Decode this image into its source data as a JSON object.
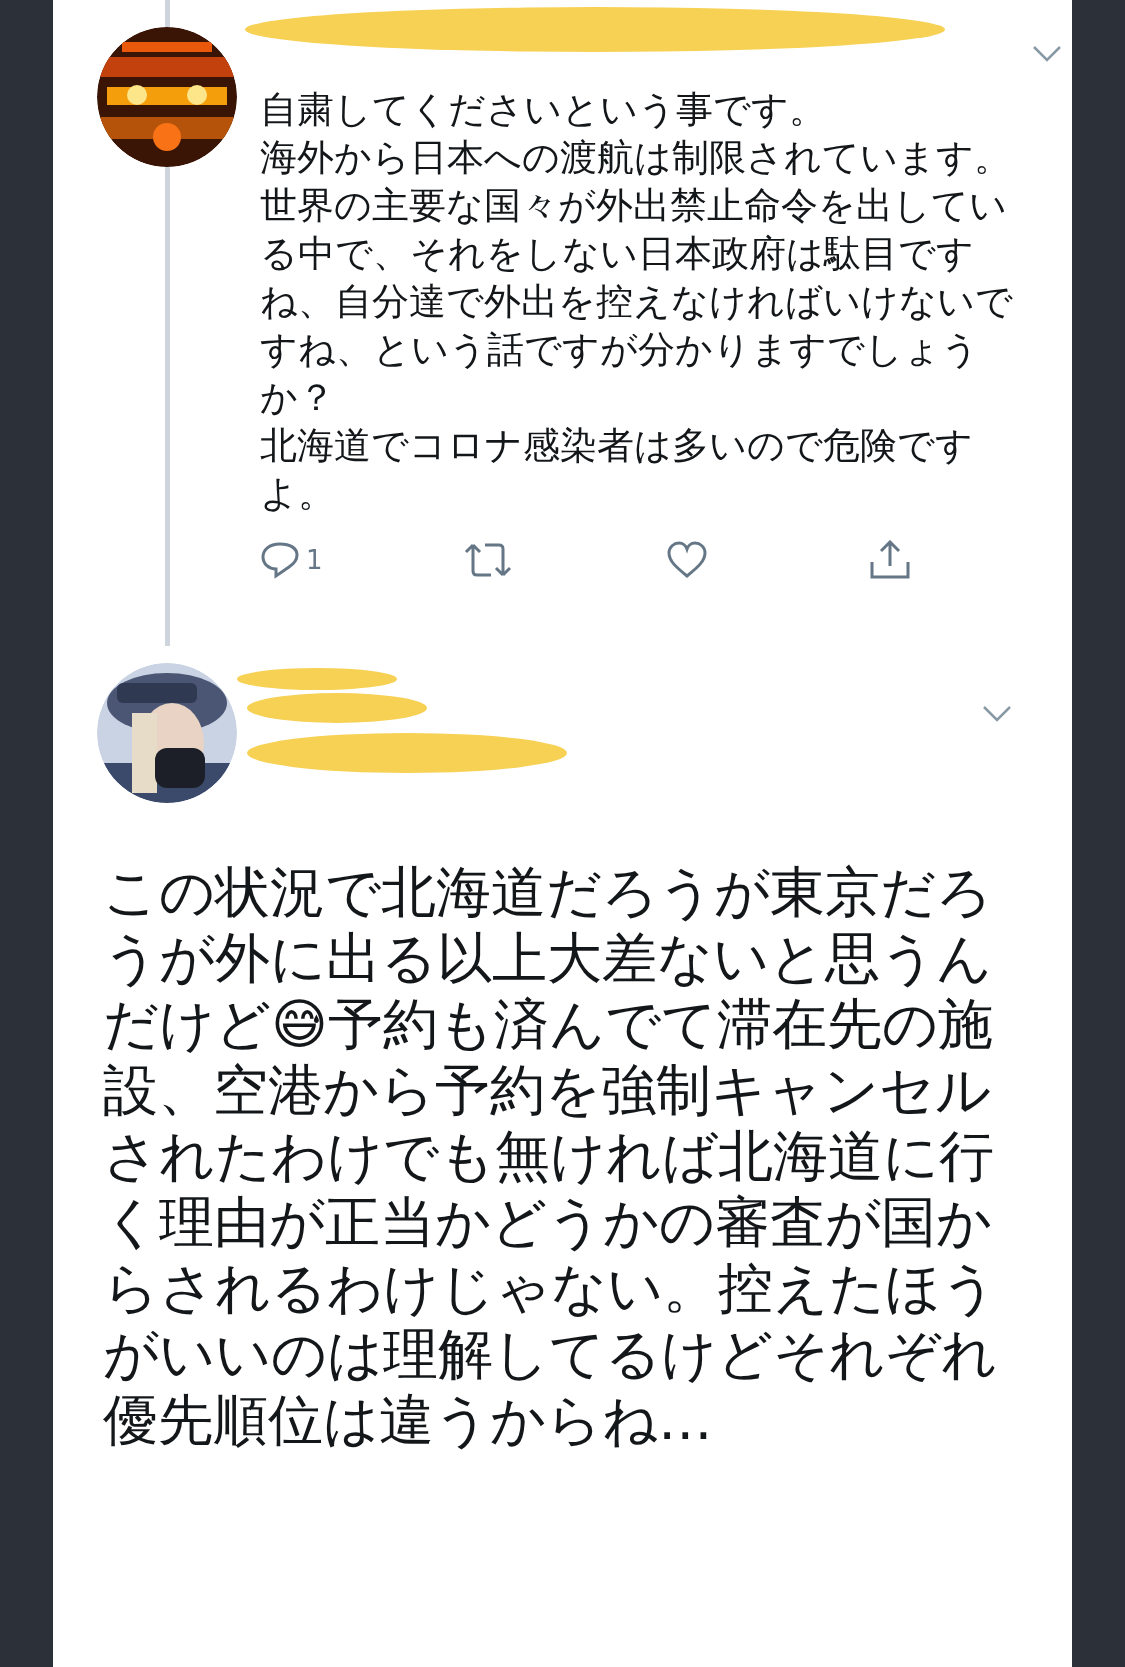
{
  "tweets": [
    {
      "kind": "reply",
      "paragraphs": [
        "自粛してくださいという事です。",
        "海外から日本への渡航は制限されています。",
        "世界の主要な国々が外出禁止命令を出している中で、それをしない日本政府は駄目ですね、自分達で外出を控えなければいけないですね、という話ですが分かりますでしょうか？",
        "北海道でコロナ感染者は多いので危険ですよ。"
      ],
      "reply_count": "1"
    },
    {
      "kind": "main",
      "paragraphs": [
        "この状況で北海道だろうが東京だろうが外に出る以上大差ないと思うんだけど😅予約も済んでて滞在先の施設、空港から予約を強制キャンセルされたわけでも無ければ北海道に行く理由が正当かどうかの審査が国からされるわけじゃない。控えたほうがいいのは理解してるけどそれぞれ優先順位は違うからね…"
      ]
    }
  ]
}
